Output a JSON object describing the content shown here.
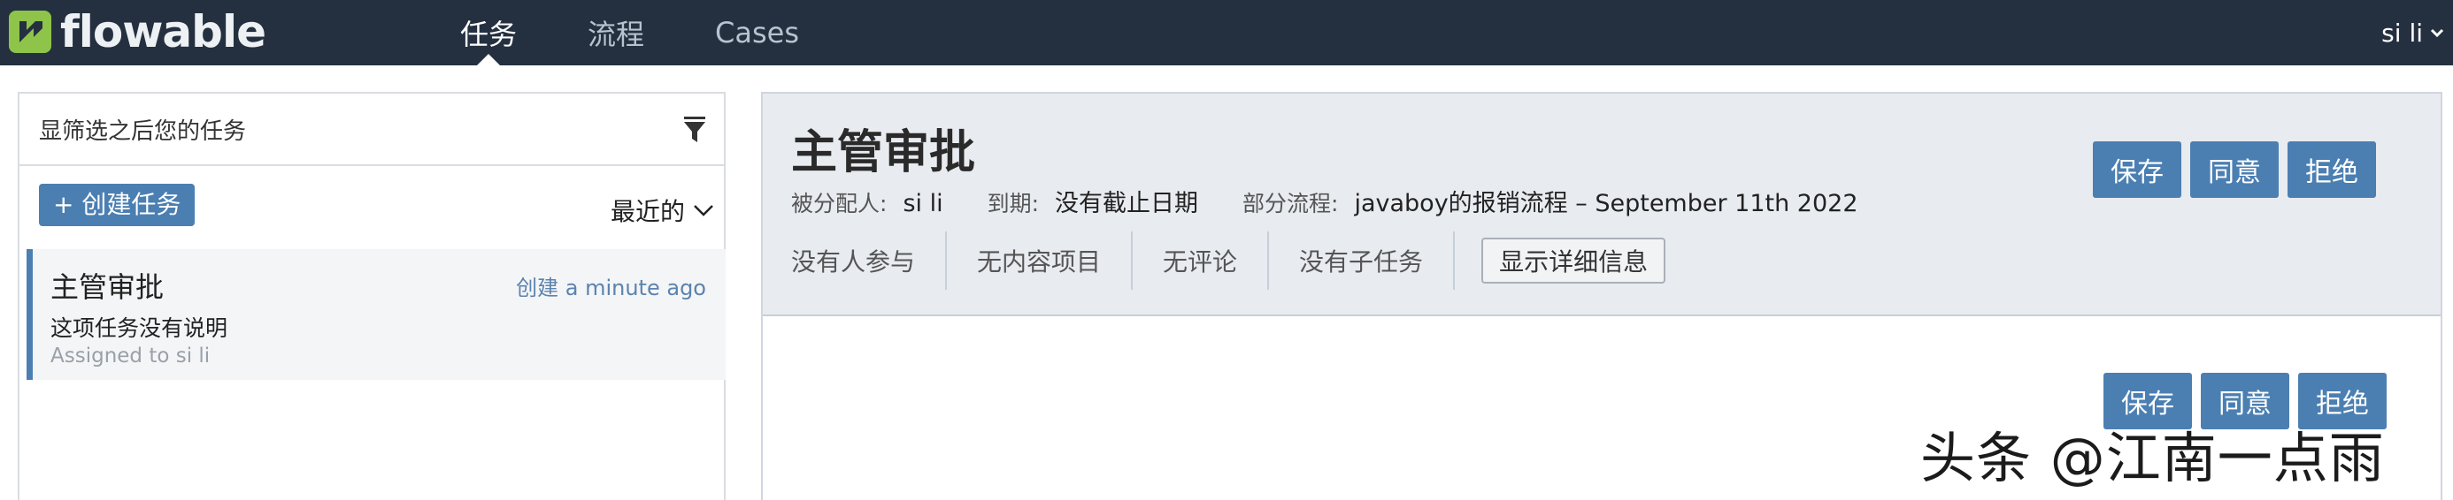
{
  "navbar": {
    "brand": "flowable",
    "tabs": [
      {
        "label": "任务",
        "active": true
      },
      {
        "label": "流程",
        "active": false
      },
      {
        "label": "Cases",
        "active": false
      }
    ],
    "user": "si li",
    "colors": {
      "background": "#243040",
      "logo_green": "#8fc44a"
    }
  },
  "task_list": {
    "filter_placeholder": "显筛选之后您的任务",
    "filter_icon": "funnel-icon",
    "create_label": "+ 创建任务",
    "sort_label": "最近的",
    "items": [
      {
        "title": "主管审批",
        "created": "创建 a minute ago",
        "description": "这项任务没有说明",
        "assignee": "Assigned to si li"
      }
    ]
  },
  "task_detail": {
    "title": "主管审批",
    "assignee_label": "被分配人:",
    "assignee_value": "si li",
    "due_label": "到期:",
    "due_value": "没有截止日期",
    "process_label": "部分流程:",
    "process_value": "javaboy的报销流程 – September 11th 2022",
    "info": {
      "participants": "没有人参与",
      "content": "无内容项目",
      "comments": "无评论",
      "subtasks": "没有子任务",
      "show_details": "显示详细信息"
    },
    "actions": {
      "save": "保存",
      "approve": "同意",
      "reject": "拒绝"
    },
    "accent_color": "#4b7fb2"
  },
  "watermark": "头条 @江南一点雨"
}
